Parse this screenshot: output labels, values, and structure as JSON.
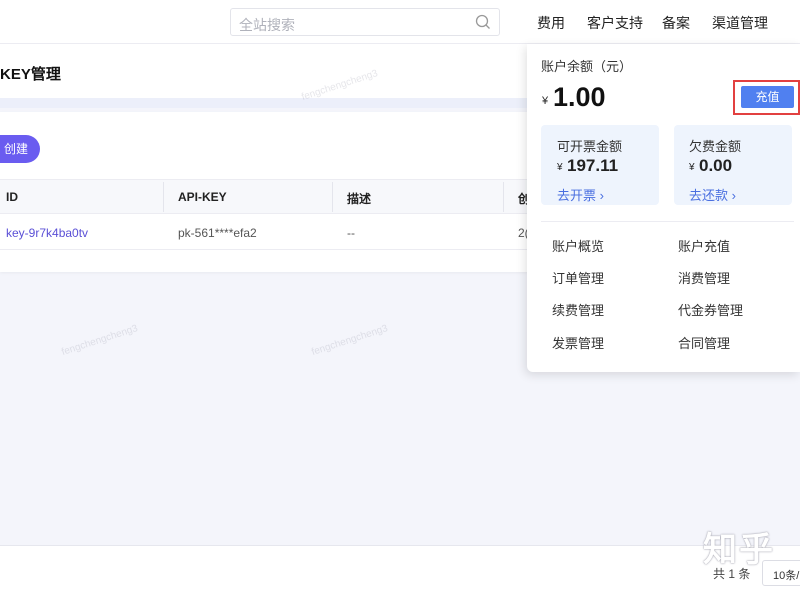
{
  "header": {
    "search_placeholder": "全站搜索",
    "nav": [
      "费用",
      "客户支持",
      "备案",
      "渠道管理"
    ]
  },
  "page": {
    "title": "KEY管理",
    "create_label": "创建"
  },
  "table": {
    "headers": [
      "ID",
      "API-KEY",
      "描述",
      "创"
    ],
    "rows": [
      {
        "id": "key-9r7k4ba0tv",
        "api_key": "pk-561****efa2",
        "desc": "--",
        "created": "2("
      }
    ]
  },
  "footer": {
    "total": "共 1 条",
    "page_size": "10条/"
  },
  "balance_panel": {
    "label": "账户余额（元）",
    "currency": "¥",
    "value": "1.00",
    "recharge_label": "充值",
    "invoiceable": {
      "label": "可开票金额",
      "currency": "¥",
      "value": "197.11",
      "link": "去开票 ›"
    },
    "owed": {
      "label": "欠费金额",
      "currency": "¥",
      "value": "0.00",
      "link": "去还款 ›"
    },
    "menu": [
      "账户概览",
      "账户充值",
      "订单管理",
      "消费管理",
      "续费管理",
      "代金券管理",
      "发票管理",
      "合同管理"
    ]
  },
  "watermark": "fengchengcheng3",
  "brand_watermark": "知乎",
  "colors": {
    "accent": "#6a5cf0",
    "recharge_button": "#5080f0",
    "highlight_border": "#e24040",
    "link": "#4a6fe0"
  }
}
